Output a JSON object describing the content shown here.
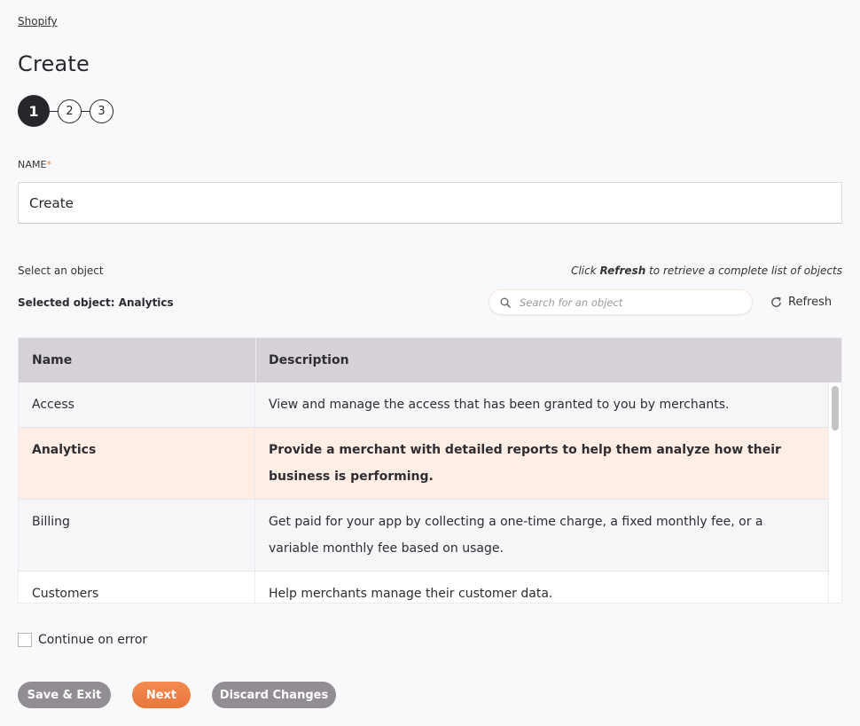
{
  "breadcrumb": "Shopify",
  "page_title": "Create",
  "stepper": {
    "steps": [
      "1",
      "2",
      "3"
    ],
    "active_step": 1
  },
  "name_field": {
    "label": "NAME",
    "required_marker": "*",
    "value": "Create"
  },
  "object_selector": {
    "label": "Select an object",
    "hint_prefix": "Click ",
    "hint_bold": "Refresh",
    "hint_suffix": " to retrieve a complete list of objects",
    "selected_text": "Selected object: Analytics",
    "search_placeholder": "Search for an object",
    "refresh_label": "Refresh"
  },
  "table": {
    "columns": [
      "Name",
      "Description"
    ],
    "rows": [
      {
        "name": "Access",
        "description": "View and manage the access that has been granted to you by merchants.",
        "selected": false
      },
      {
        "name": "Analytics",
        "description": "Provide a merchant with detailed reports to help them analyze how their business is performing.",
        "selected": true
      },
      {
        "name": "Billing",
        "description": "Get paid for your app by collecting a one-time charge, a fixed monthly fee, or a variable monthly fee based on usage.",
        "selected": false
      },
      {
        "name": "Customers",
        "description": "Help merchants manage their customer data.",
        "selected": false
      }
    ]
  },
  "continue_on_error": {
    "label": "Continue on error",
    "checked": false
  },
  "buttons": {
    "save_exit": "Save & Exit",
    "next": "Next",
    "discard": "Discard Changes"
  },
  "colors": {
    "accent": "#ee7f45",
    "selected_row": "#ffeee6",
    "header_bg": "#d6d1d6",
    "step_active": "#26262b"
  }
}
